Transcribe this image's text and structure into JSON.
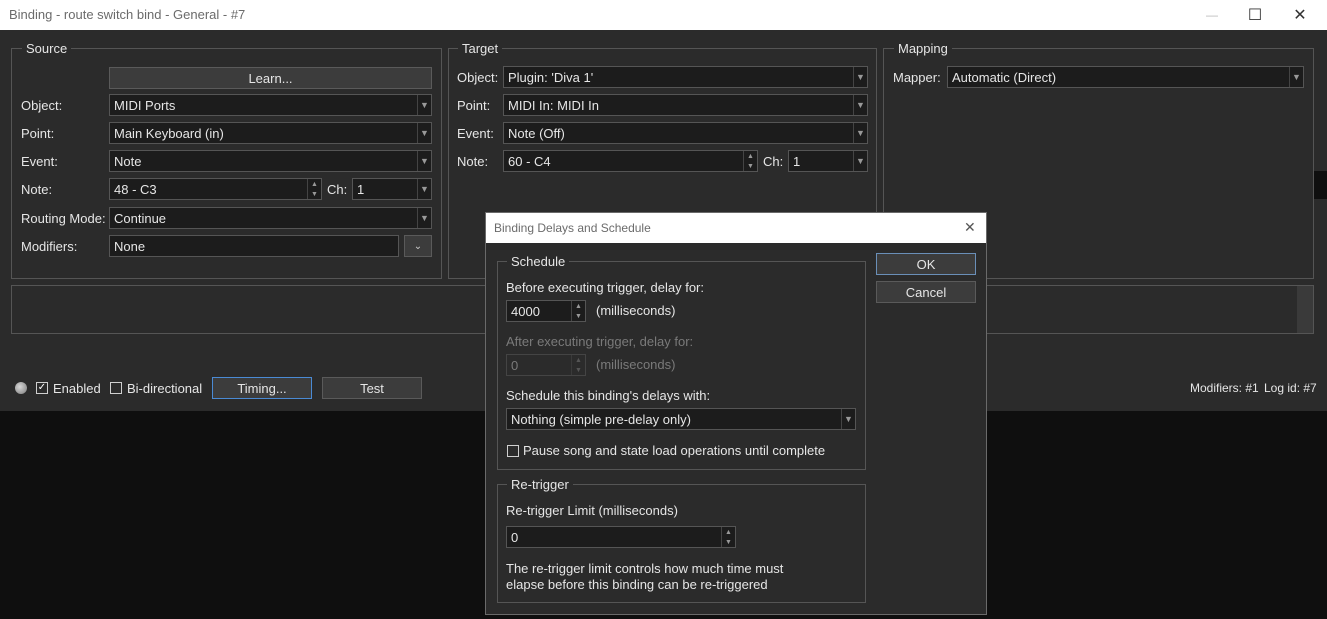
{
  "window": {
    "title": "Binding - route switch bind - General - #7",
    "minimize": "—",
    "maximize": "☐",
    "close": "✕"
  },
  "source": {
    "title": "Source",
    "learn_label": "Learn...",
    "object_label": "Object:",
    "object_value": "MIDI Ports",
    "point_label": "Point:",
    "point_value": "Main Keyboard (in)",
    "event_label": "Event:",
    "event_value": "Note",
    "note_label": "Note:",
    "note_value": "48 - C3",
    "ch_label": "Ch:",
    "ch_value": "1",
    "routing_label": "Routing Mode:",
    "routing_value": "Continue",
    "modifiers_label": "Modifiers:",
    "modifiers_value": "None"
  },
  "target": {
    "title": "Target",
    "object_label": "Object:",
    "object_value": "Plugin: 'Diva 1'",
    "point_label": "Point:",
    "point_value": "MIDI In: MIDI In",
    "event_label": "Event:",
    "event_value": "Note (Off)",
    "note_label": "Note:",
    "note_value": "60 - C4",
    "ch_label": "Ch:",
    "ch_value": "1"
  },
  "mapping": {
    "title": "Mapping",
    "mapper_label": "Mapper:",
    "mapper_value": "Automatic (Direct)"
  },
  "footer": {
    "enabled_label": "Enabled",
    "enabled_checked": true,
    "bidirectional_label": "Bi-directional",
    "bidirectional_checked": false,
    "timing_label": "Timing...",
    "test_label": "Test",
    "modifiers_status": "Modifiers: #1",
    "log_status": "Log id: #7"
  },
  "dialog": {
    "title": "Binding Delays and Schedule",
    "close": "✕",
    "ok_label": "OK",
    "cancel_label": "Cancel",
    "schedule": {
      "title": "Schedule",
      "before_label": "Before executing trigger, delay for:",
      "before_value": "4000",
      "before_unit": "(milliseconds)",
      "after_label": "After executing trigger, delay for:",
      "after_value": "0",
      "after_unit": "(milliseconds)",
      "schedule_label": "Schedule this binding's delays with:",
      "schedule_value": "Nothing (simple pre-delay only)",
      "pause_label": "Pause song and state load operations until complete",
      "pause_checked": false
    },
    "retrigger": {
      "title": "Re-trigger",
      "limit_label": "Re-trigger Limit (milliseconds)",
      "limit_value": "0",
      "note_line1": "The re-trigger limit controls how much time must",
      "note_line2": "elapse before this binding can be re-triggered"
    }
  }
}
